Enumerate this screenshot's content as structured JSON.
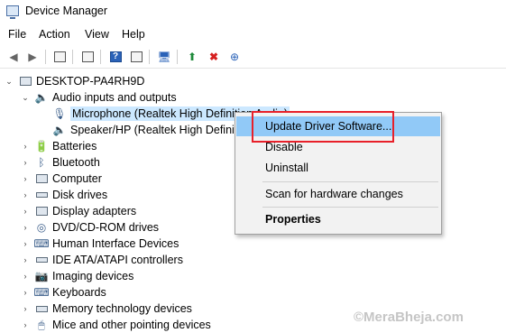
{
  "window": {
    "title": "Device Manager",
    "app_icon": "device-manager-icon"
  },
  "menu": [
    "File",
    "Action",
    "View",
    "Help"
  ],
  "toolbar": {
    "buttons": [
      "back-arrow-icon",
      "forward-arrow-icon",
      "properties-grid-icon",
      "show-hide-tree-icon",
      "help-icon",
      "view-icon",
      "computer-scan-icon",
      "update-driver-icon",
      "uninstall-device-icon",
      "add-hardware-icon"
    ]
  },
  "tree": {
    "root": "DESKTOP-PA4RH9D",
    "audio_group": "Audio inputs and outputs",
    "audio_children": [
      "Microphone (Realtek High Definition Audio)",
      "Speaker/HP (Realtek High Definiti"
    ],
    "categories": [
      "Batteries",
      "Bluetooth",
      "Computer",
      "Disk drives",
      "Display adapters",
      "DVD/CD-ROM drives",
      "Human Interface Devices",
      "IDE ATA/ATAPI controllers",
      "Imaging devices",
      "Keyboards",
      "Memory technology devices",
      "Mice and other pointing devices"
    ]
  },
  "context_menu": {
    "items": [
      "Update Driver Software...",
      "Disable",
      "Uninstall",
      "Scan for hardware changes",
      "Properties"
    ],
    "highlight_color": "#91c9f7"
  },
  "annotation": {
    "box_color": "#e8202a"
  },
  "watermark": "©MeraBheja.com"
}
